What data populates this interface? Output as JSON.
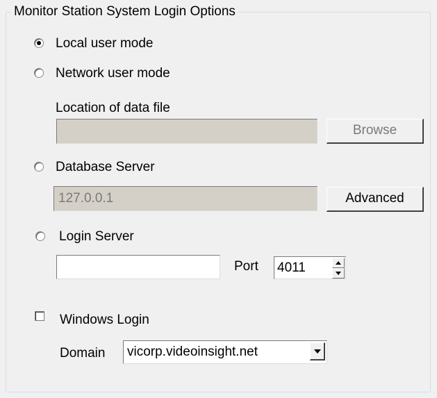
{
  "group": {
    "title": "Monitor Station System Login Options"
  },
  "options": {
    "local_user_mode": "Local user mode",
    "network_user_mode": "Network user mode",
    "database_server": "Database Server",
    "login_server": "Login Server",
    "selected": "local_user_mode"
  },
  "network": {
    "location_label": "Location of data file",
    "location_value": "",
    "browse_label": "Browse"
  },
  "database": {
    "server_value": "127.0.0.1",
    "advanced_label": "Advanced"
  },
  "login_server": {
    "host_value": "",
    "port_label": "Port",
    "port_value": "4011"
  },
  "windows_login": {
    "label": "Windows Login",
    "checked": false,
    "domain_label": "Domain",
    "domain_value": "vicorp.videoinsight.net"
  },
  "icons": {
    "spin_up": "triangle-up-icon",
    "spin_down": "triangle-down-icon",
    "dropdown": "chevron-down-icon"
  }
}
